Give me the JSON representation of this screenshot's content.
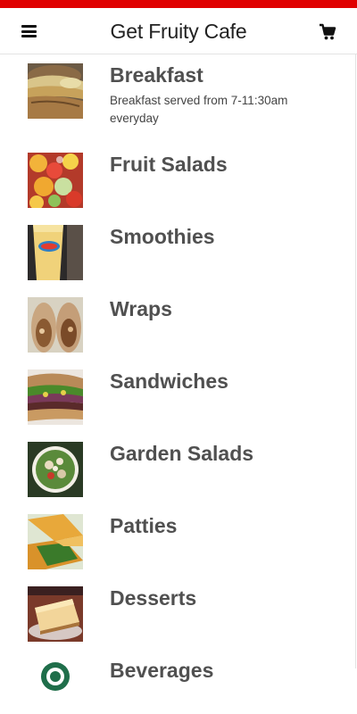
{
  "header": {
    "title": "Get Fruity Cafe",
    "menu_icon": "hamburger-menu-icon",
    "cart_icon": "shopping-cart-icon"
  },
  "colors": {
    "accent": "#e00000",
    "text": "#505050"
  },
  "categories": [
    {
      "name": "Breakfast",
      "description": "Breakfast served from 7-11:30am everyday",
      "image": "breakfast-sandwich-photo"
    },
    {
      "name": "Fruit Salads",
      "description": "",
      "image": "fruit-salad-photo"
    },
    {
      "name": "Smoothies",
      "description": "",
      "image": "smoothie-cup-photo"
    },
    {
      "name": "Wraps",
      "description": "",
      "image": "wrap-photo"
    },
    {
      "name": "Sandwiches",
      "description": "",
      "image": "sandwich-photo"
    },
    {
      "name": "Garden Salads",
      "description": "",
      "image": "garden-salad-photo"
    },
    {
      "name": "Patties",
      "description": "",
      "image": "patty-photo"
    },
    {
      "name": "Desserts",
      "description": "",
      "image": "cheesecake-photo"
    },
    {
      "name": "Beverages",
      "description": "",
      "image": "beverage-photo"
    }
  ]
}
